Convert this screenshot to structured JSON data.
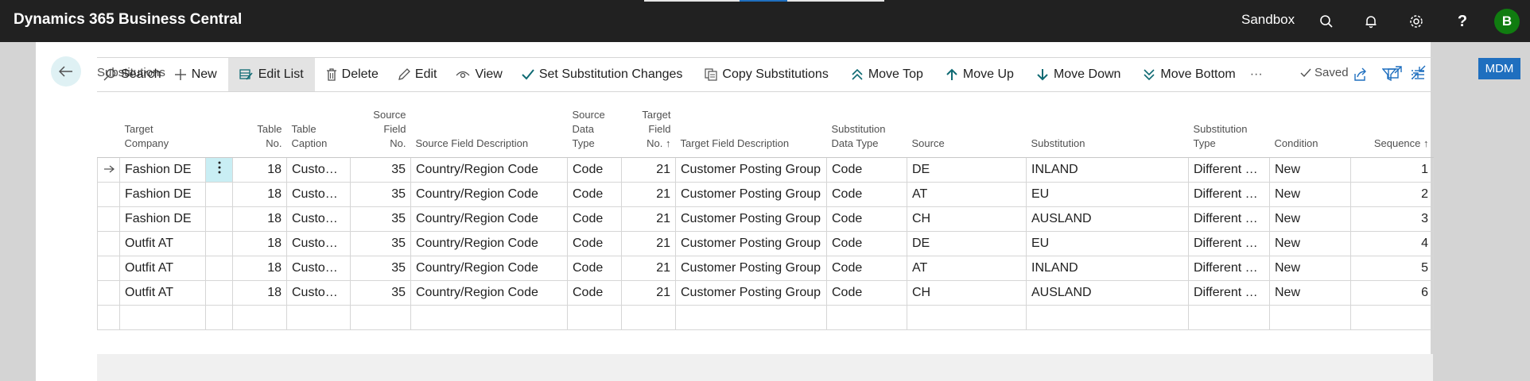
{
  "app": {
    "brand": "Dynamics 365 Business Central",
    "environment": "Sandbox",
    "avatar_initial": "B",
    "icons": [
      "search-icon",
      "bell-icon",
      "gear-icon",
      "help-icon"
    ]
  },
  "side_badge": "MDM",
  "page": {
    "title": "Substitutions",
    "saved_label": "Saved"
  },
  "toolbar": {
    "search": "Search",
    "new": "New",
    "edit_list": "Edit List",
    "delete": "Delete",
    "edit": "Edit",
    "view": "View",
    "set_substitution_changes": "Set Substitution Changes",
    "copy_substitutions": "Copy Substitutions",
    "move_top": "Move Top",
    "move_up": "Move Up",
    "move_down": "Move Down",
    "move_bottom": "Move Bottom",
    "more": "···"
  },
  "columns": {
    "target_company_1": "Target",
    "target_company_2": "Company",
    "table_no_1": "Table",
    "table_no_2": "No.",
    "table_caption_1": "Table",
    "table_caption_2": "Caption",
    "source_field_no_1": "Source",
    "source_field_no_2": "Field",
    "source_field_no_3": "No.",
    "source_field_desc": "Source Field Description",
    "source_data_type_1": "Source",
    "source_data_type_2": "Data",
    "source_data_type_3": "Type",
    "target_field_no_1": "Target",
    "target_field_no_2": "Field",
    "target_field_no_3": "No. ↑",
    "target_field_desc": "Target Field Description",
    "subst_data_type_1": "Substitution",
    "subst_data_type_2": "Data Type",
    "source": "Source",
    "substitution": "Substitution",
    "subst_type_1": "Substitution",
    "subst_type_2": "Type",
    "condition": "Condition",
    "sequence": "Sequence ↑"
  },
  "rows": [
    {
      "target_company": "Fashion DE",
      "table_no": "18",
      "table_caption": "Customer",
      "source_field_no": "35",
      "source_field_desc": "Country/Region Code",
      "source_data_type": "Code",
      "target_field_no": "21",
      "target_field_desc": "Customer Posting Group",
      "subst_data_type": "Code",
      "source": "DE",
      "substitution": "INLAND",
      "subst_type": "Different Fi...",
      "condition": "New",
      "sequence": "1"
    },
    {
      "target_company": "Fashion DE",
      "table_no": "18",
      "table_caption": "Customer",
      "source_field_no": "35",
      "source_field_desc": "Country/Region Code",
      "source_data_type": "Code",
      "target_field_no": "21",
      "target_field_desc": "Customer Posting Group",
      "subst_data_type": "Code",
      "source": "AT",
      "substitution": "EU",
      "subst_type": "Different Fi...",
      "condition": "New",
      "sequence": "2"
    },
    {
      "target_company": "Fashion DE",
      "table_no": "18",
      "table_caption": "Customer",
      "source_field_no": "35",
      "source_field_desc": "Country/Region Code",
      "source_data_type": "Code",
      "target_field_no": "21",
      "target_field_desc": "Customer Posting Group",
      "subst_data_type": "Code",
      "source": "CH",
      "substitution": "AUSLAND",
      "subst_type": "Different Fi...",
      "condition": "New",
      "sequence": "3"
    },
    {
      "target_company": "Outfit AT",
      "table_no": "18",
      "table_caption": "Customer",
      "source_field_no": "35",
      "source_field_desc": "Country/Region Code",
      "source_data_type": "Code",
      "target_field_no": "21",
      "target_field_desc": "Customer Posting Group",
      "subst_data_type": "Code",
      "source": "DE",
      "substitution": "EU",
      "subst_type": "Different Fi...",
      "condition": "New",
      "sequence": "4"
    },
    {
      "target_company": "Outfit AT",
      "table_no": "18",
      "table_caption": "Customer",
      "source_field_no": "35",
      "source_field_desc": "Country/Region Code",
      "source_data_type": "Code",
      "target_field_no": "21",
      "target_field_desc": "Customer Posting Group",
      "subst_data_type": "Code",
      "source": "AT",
      "substitution": "INLAND",
      "subst_type": "Different Fi...",
      "condition": "New",
      "sequence": "5"
    },
    {
      "target_company": "Outfit AT",
      "table_no": "18",
      "table_caption": "Customer",
      "source_field_no": "35",
      "source_field_desc": "Country/Region Code",
      "source_data_type": "Code",
      "target_field_no": "21",
      "target_field_desc": "Customer Posting Group",
      "subst_data_type": "Code",
      "source": "CH",
      "substitution": "AUSLAND",
      "subst_type": "Different Fi...",
      "condition": "New",
      "sequence": "6"
    }
  ],
  "colors": {
    "topbar": "#212121",
    "accent": "#1f6fbf",
    "avatar": "#107c10",
    "selected_cell": "#c9eef4"
  }
}
